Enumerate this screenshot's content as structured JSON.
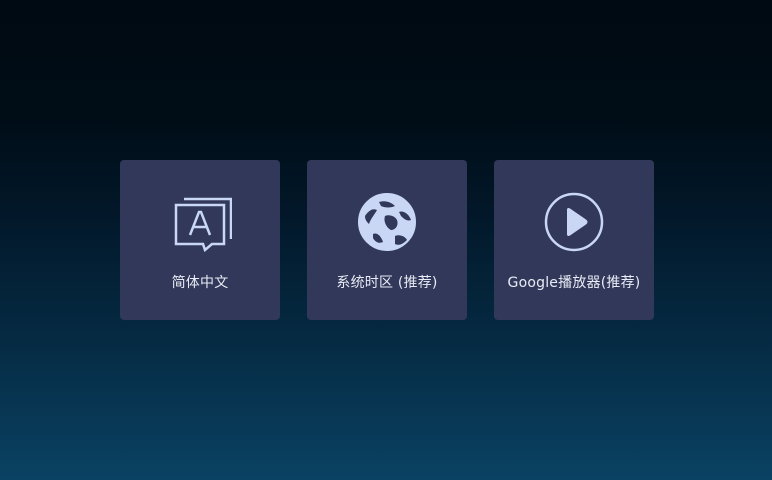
{
  "menu": {
    "tiles": [
      {
        "label": "简体中文",
        "icon": "language-icon"
      },
      {
        "label": "系统时区 (推荐)",
        "icon": "globe-icon"
      },
      {
        "label": "Google播放器(推荐)",
        "icon": "play-circle-icon"
      }
    ]
  },
  "colors": {
    "tile_background": "#32385a",
    "icon_color": "#c9d7f5",
    "label_color": "#e9ecf5"
  }
}
